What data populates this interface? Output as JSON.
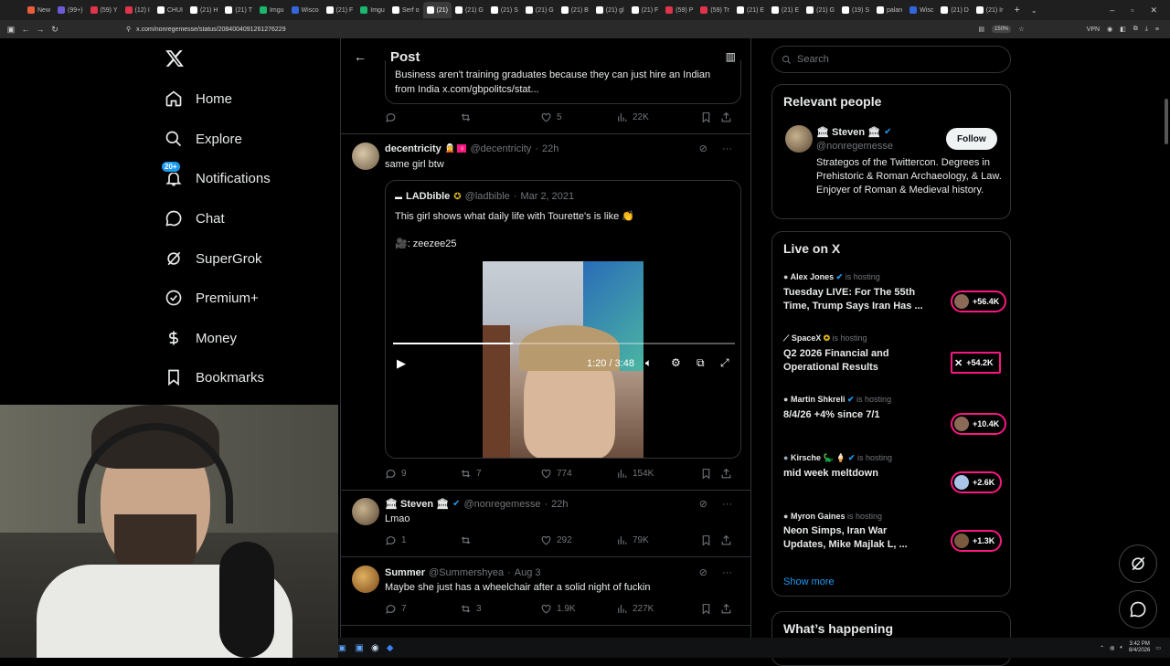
{
  "browser": {
    "tabs": [
      {
        "label": "New",
        "color": "#e85d3b"
      },
      {
        "label": "(99+)",
        "color": "#6b5bd6"
      },
      {
        "label": "(59) Y",
        "color": "#e0334c"
      },
      {
        "label": "(12) I",
        "color": "#e0334c"
      },
      {
        "label": "CHUI",
        "color": "#ffffff"
      },
      {
        "label": "(21) H",
        "color": "#ffffff"
      },
      {
        "label": "(21) T",
        "color": "#ffffff"
      },
      {
        "label": "Imgu",
        "color": "#1bb76e"
      },
      {
        "label": "Wisco",
        "color": "#3366dd"
      },
      {
        "label": "(21) F",
        "color": "#ffffff"
      },
      {
        "label": "Imgu",
        "color": "#1bb76e"
      },
      {
        "label": "Serf o",
        "color": "#ffffff"
      },
      {
        "label": "(21)",
        "color": "#ffffff"
      },
      {
        "label": "(21) G",
        "color": "#ffffff"
      },
      {
        "label": "(21) S",
        "color": "#ffffff"
      },
      {
        "label": "(21) G",
        "color": "#ffffff"
      },
      {
        "label": "(21) B",
        "color": "#ffffff"
      },
      {
        "label": "(21) gl",
        "color": "#ffffff"
      },
      {
        "label": "(21) F",
        "color": "#ffffff"
      },
      {
        "label": "(59) P",
        "color": "#e0334c"
      },
      {
        "label": "(59) Tr",
        "color": "#e0334c"
      },
      {
        "label": "(21) E",
        "color": "#ffffff"
      },
      {
        "label": "(21) E",
        "color": "#ffffff"
      },
      {
        "label": "(21) G",
        "color": "#ffffff"
      },
      {
        "label": "(19) S",
        "color": "#ffffff"
      },
      {
        "label": "palan",
        "color": "#ffffff"
      },
      {
        "label": "Wisc",
        "color": "#3366dd"
      },
      {
        "label": "(21) D",
        "color": "#ffffff"
      },
      {
        "label": "(21) Ir",
        "color": "#ffffff"
      }
    ],
    "active_tab_index": 12,
    "url": "x.com/nonregemesse/status/2084004091261276229",
    "zoom": "150%",
    "vpn": "VPN"
  },
  "nav": {
    "items": [
      {
        "label": "Home",
        "icon": "home-icon"
      },
      {
        "label": "Explore",
        "icon": "search-icon"
      },
      {
        "label": "Notifications",
        "icon": "bell-icon",
        "badge": "20+"
      },
      {
        "label": "Chat",
        "icon": "chat-icon"
      },
      {
        "label": "SuperGrok",
        "icon": "grok-icon"
      },
      {
        "label": "Premium+",
        "icon": "verified-icon"
      },
      {
        "label": "Money",
        "icon": "money-icon"
      },
      {
        "label": "Bookmarks",
        "icon": "bookmark-icon"
      }
    ]
  },
  "post": {
    "header_title": "Post",
    "quoted_prev_text_1": "Business aren't training graduates because they can just hire an Indian",
    "quoted_prev_text_2": "from India x.com/gbpolitcs/stat...",
    "prev_actions": {
      "replies": "",
      "reposts": "",
      "likes": "5",
      "views": "22K"
    },
    "reply1": {
      "name": "decentricity",
      "handle": "@decentricity",
      "time": "22h",
      "text": "same girl btw",
      "quote": {
        "name": "LADbible",
        "handle": "@ladbible",
        "date": "Mar 2, 2021",
        "text": "This girl shows what daily life with Tourette's is like 👏",
        "credit": "🎥: zeezee25",
        "video_time": "1:20 / 3:48",
        "video_progress": 0.35
      },
      "actions": {
        "replies": "9",
        "reposts": "7",
        "likes": "774",
        "views": "154K"
      }
    },
    "reply2": {
      "name": "🏛 Steven 🏛",
      "handle": "@nonregemesse",
      "time": "22h",
      "text": "Lmao",
      "actions": {
        "replies": "1",
        "reposts": "",
        "likes": "292",
        "views": "79K"
      }
    },
    "reply3": {
      "name": "Summer",
      "handle": "@Summershyea",
      "time": "Aug 3",
      "text": "Maybe she just has a wheelchair after a solid night of fuckin",
      "actions": {
        "replies": "7",
        "reposts": "3",
        "likes": "1.9K",
        "views": "227K"
      }
    }
  },
  "right": {
    "search_placeholder": "Search",
    "relevant_title": "Relevant people",
    "relevant_person": {
      "name": "🏛 Steven 🏛",
      "handle": "@nonregemesse",
      "follow_label": "Follow",
      "bio": "Strategos of the Twittercon. Degrees in Prehistoric & Roman Archaeology, & Law. Enjoyer of Roman & Medieval history."
    },
    "live_title": "Live on X",
    "hosting_label": "is hosting",
    "live": [
      {
        "host": "Alex Jones",
        "title": "Tuesday LIVE: For The 55th Time, Trump Says Iran Has ...",
        "count": "+56.4K"
      },
      {
        "host": "SpaceX",
        "title": "Q2 2026 Financial and Operational Results",
        "count": "+54.2K"
      },
      {
        "host": "Martin Shkreli",
        "title": "8/4/26 +4% since 7/1",
        "count": "+10.4K"
      },
      {
        "host": "Kirsche 🦕 🍦",
        "title": "mid week meltdown",
        "count": "+2.6K"
      },
      {
        "host": "Myron Gaines",
        "title": "Neon Simps, Iran War Updates, Mike Majlak L, ...",
        "count": "+1.3K"
      }
    ],
    "show_more": "Show more",
    "whats_happening": "What’s happening"
  },
  "taskbar": {
    "time": "3:42 PM",
    "date": "8/4/2026"
  },
  "colors": {
    "accent": "#1d9bf0",
    "live_pink": "#f91880",
    "muted": "#71767b",
    "border": "#2f3336"
  }
}
